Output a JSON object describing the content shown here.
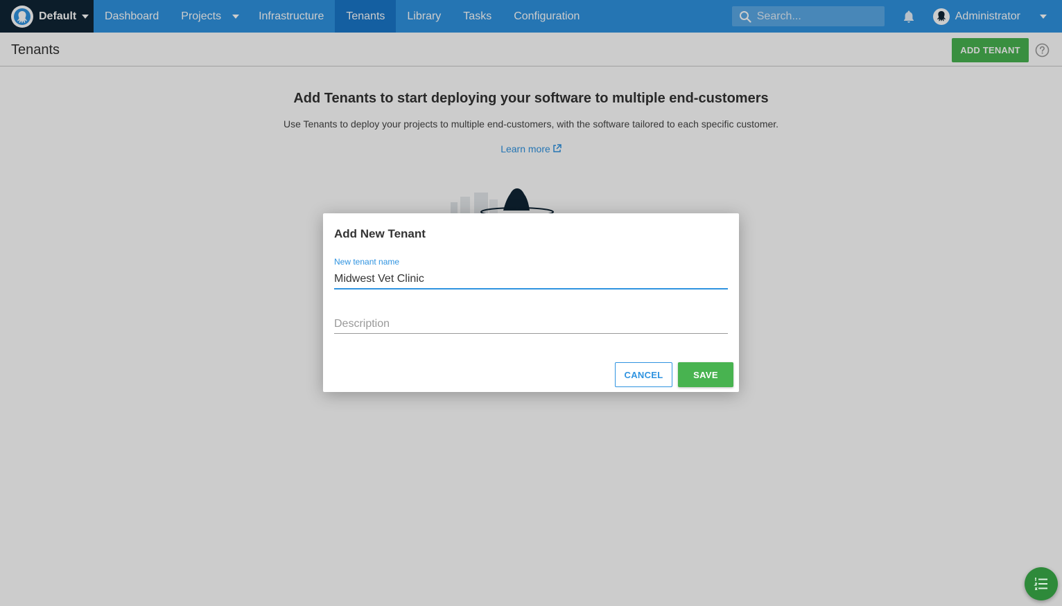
{
  "nav": {
    "space_name": "Default",
    "items": [
      {
        "label": "Dashboard"
      },
      {
        "label": "Projects"
      },
      {
        "label": "Infrastructure"
      },
      {
        "label": "Tenants"
      },
      {
        "label": "Library"
      },
      {
        "label": "Tasks"
      },
      {
        "label": "Configuration"
      }
    ],
    "active_item": "Tenants",
    "search_placeholder": "Search...",
    "user_name": "Administrator"
  },
  "page": {
    "title": "Tenants",
    "add_button": "ADD TENANT"
  },
  "onboarding": {
    "heading": "Add Tenants to start deploying your software to multiple end-customers",
    "subtext": "Use Tenants to deploy your projects to multiple end-customers, with the software tailored to each specific customer.",
    "learn_more": "Learn more"
  },
  "dialog": {
    "title": "Add New Tenant",
    "name_label": "New tenant name",
    "name_value": "Midwest Vet Clinic",
    "description_placeholder": "Description",
    "description_value": "",
    "cancel_label": "CANCEL",
    "save_label": "SAVE"
  },
  "colors": {
    "nav_bg": "#2f93e0",
    "nav_active": "#1a77ca",
    "space_bg": "#0f2535",
    "primary_green": "#48b350",
    "link_blue": "#2f93e0"
  },
  "icons": [
    "octopus-logo-icon",
    "chevron-down-icon",
    "search-icon",
    "bell-icon",
    "user-avatar-icon",
    "help-icon",
    "external-link-icon",
    "task-list-icon"
  ]
}
